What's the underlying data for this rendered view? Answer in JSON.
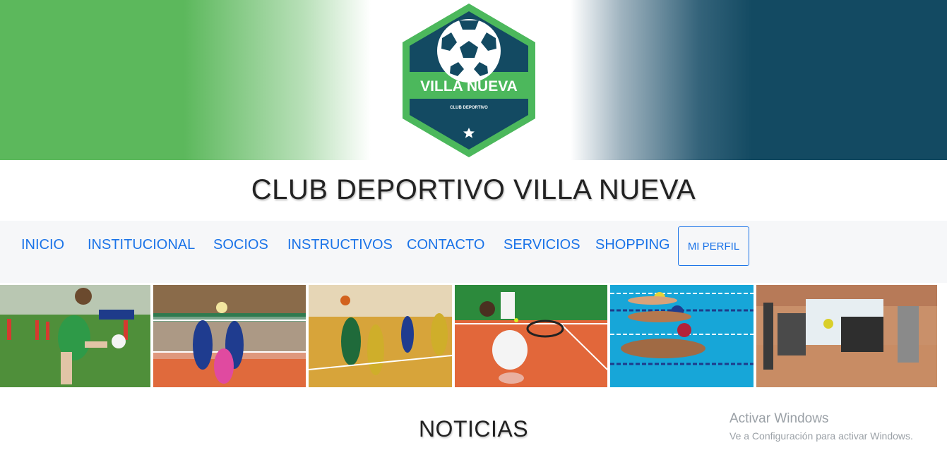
{
  "header": {
    "logo": {
      "name": "VILLA NUEVA",
      "subtitle": "CLUB DEPORTIVO",
      "icon": "soccer-ball-icon",
      "colors": {
        "green": "#4caf50",
        "navy": "#134a62"
      }
    }
  },
  "site": {
    "title": "CLUB DEPORTIVO VILLA NUEVA"
  },
  "nav": {
    "items": [
      {
        "label": "INICIO"
      },
      {
        "label": "INSTITUCIONAL"
      },
      {
        "label": "SOCIOS"
      },
      {
        "label": "INSTRUCTIVOS"
      },
      {
        "label": "CONTACTO"
      },
      {
        "label": "SERVICIOS"
      },
      {
        "label": "SHOPPING"
      }
    ],
    "profile_button": "MI PERFIL",
    "link_color": "#1a73e8"
  },
  "gallery": {
    "images": [
      {
        "subject": "soccer"
      },
      {
        "subject": "volleyball"
      },
      {
        "subject": "basketball"
      },
      {
        "subject": "tennis"
      },
      {
        "subject": "swimming"
      },
      {
        "subject": "gym"
      }
    ]
  },
  "section": {
    "title": "NOTICIAS"
  },
  "watermark": {
    "title": "Activar Windows",
    "subtitle": "Ve a Configuración para activar Windows."
  }
}
